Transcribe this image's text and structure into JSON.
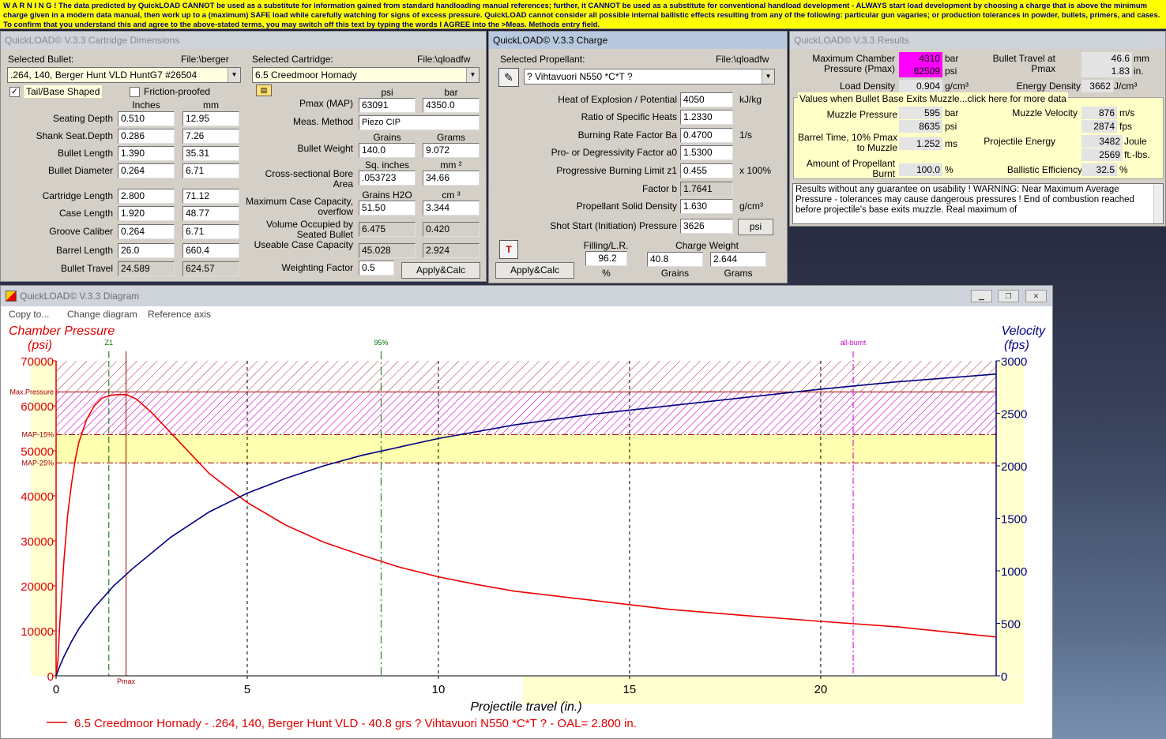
{
  "warning": "W A R N I N G ! The data predicted by QuickLOAD CANNOT be used as a substitute for information gained from standard handloading manual references; further, it CANNOT be used as a substitute for conventional handload development - ALWAYS start load development by choosing a charge that is above the minimum charge given in a modern data manual, then work up to a (maximum) SAFE load while carefully watching for signs of excess pressure. QuickLOAD cannot consider all possible internal ballistic effects resulting from any of the following: particular gun vagaries; or production tolerances in powder, bullets, primers, and cases. To confirm that you understand this and agree to the above-stated terms, you may switch off this text by typing the words I AGREE into the >Meas. Methods entry field.",
  "dims": {
    "title": "QuickLOAD© V.3.3 Cartridge Dimensions",
    "selected_bullet_label": "Selected Bullet:",
    "bullet_file": "File:\\berger",
    "bullet_value": ".264, 140, Berger Hunt VLD HuntG7 #26504",
    "tail_label": "Tail/Base Shaped",
    "friction_label": "Friction-proofed",
    "inches_hdr": "Inches",
    "mm_hdr": "mm",
    "rows": [
      {
        "label": "Seating Depth",
        "in": "0.510",
        "mm": "12.95"
      },
      {
        "label": "Shank Seat.Depth",
        "in": "0.286",
        "mm": "7.26"
      },
      {
        "label": "Bullet Length",
        "in": "1.390",
        "mm": "35.31"
      },
      {
        "label": "Bullet Diameter",
        "in": "0.264",
        "mm": "6.71"
      },
      {
        "label": "Cartridge Length",
        "in": "2.800",
        "mm": "71.12"
      },
      {
        "label": "Case Length",
        "in": "1.920",
        "mm": "48.77"
      },
      {
        "label": "Groove Caliber",
        "in": "0.264",
        "mm": "6.71"
      },
      {
        "label": "Barrel Length",
        "in": "26.0",
        "mm": "660.4"
      },
      {
        "label": "Bullet Travel",
        "in": "24.589",
        "mm": "624.57"
      }
    ],
    "selected_cartridge_label": "Selected Cartridge:",
    "cartridge_file": "File:\\qloadfw",
    "cartridge_value": "6.5 Creedmoor Hornady",
    "psi_hdr": "psi",
    "bar_hdr": "bar",
    "pmax_label": "Pmax (MAP)",
    "pmax_psi": "63091",
    "pmax_bar": "4350.0",
    "meas_label": "Meas. Method",
    "meas_value": "Piezo CIP",
    "grains_hdr": "Grains",
    "grams_hdr": "Grams",
    "bw_label": "Bullet Weight",
    "bw_gr": "140.0",
    "bw_g": "9.072",
    "sqin_hdr": "Sq. inches",
    "mm2_hdr": "mm ²",
    "csa_label1": "Cross-sectional Bore",
    "csa_label2": "Area",
    "csa_in": ".053723",
    "csa_mm": "34.66",
    "h2o_hdr": "Grains H2O",
    "cm3_hdr": "cm ³",
    "mcc_label1": "Maximum Case Capacity,",
    "mcc_label2": "overflow",
    "mcc_gr": "51.50",
    "mcc_cm": "3.344",
    "vol_label1": "Volume Occupied by",
    "vol_label2": "Seated Bullet",
    "vol_gr": "6.475",
    "vol_cm": "0.420",
    "ucc_label": "Useable Case Capacity",
    "ucc_gr": "45.028",
    "ucc_cm": "2.924",
    "wf_label": "Weighting Factor",
    "wf_value": "0.5",
    "apply": "Apply&Calc"
  },
  "charge": {
    "title": "QuickLOAD© V.3.3 Charge",
    "sel_label": "Selected Propellant:",
    "file": "File:\\qloadfw",
    "propellant": "? Vihtavuori N550 *C*T ?",
    "rows": [
      {
        "label": "Heat of Explosion / Potential",
        "value": "4050",
        "unit": "kJ/kg"
      },
      {
        "label": "Ratio of Specific Heats",
        "value": "1.2330",
        "unit": ""
      },
      {
        "label": "Burning Rate Factor  Ba",
        "value": "0.4700",
        "unit": "1/s"
      },
      {
        "label": "Pro- or Degressivity Factor  a0",
        "value": "1.5300",
        "unit": ""
      },
      {
        "label": "Progressive Burning Limit z1",
        "value": "0.455",
        "unit": "x 100%"
      },
      {
        "label": "Factor  b",
        "value": "1.7641",
        "unit": ""
      },
      {
        "label": "Propellant Solid Density",
        "value": "1.630",
        "unit": "g/cm³"
      },
      {
        "label": "Shot Start (Initiation) Pressure",
        "value": "3626",
        "unit": ""
      }
    ],
    "psi_btn": "psi",
    "filling_label": "Filling/L.R.",
    "filling_value": "96.2",
    "pct": "%",
    "cw_label": "Charge Weight",
    "cw_gr": "40.8",
    "cw_g": "2.644",
    "grains": "Grains",
    "grams": "Grams",
    "apply": "Apply&Calc"
  },
  "results": {
    "title": "QuickLOAD© V.3.3 Results",
    "mcp_label1": "Maximum Chamber",
    "mcp_label2": "Pressure (Pmax)",
    "mcp_bar": "4310",
    "mcp_psi": "62509",
    "bar": "bar",
    "psi": "psi",
    "btp_label1": "Bullet Travel at",
    "btp_label2": "Pmax",
    "btp_mm": "46.6",
    "btp_in": "1.83",
    "mm": "mm",
    "in": "in.",
    "ld_label": "Load Density",
    "ld_value": "0.904",
    "ld_unit": "g/cm³",
    "ed_label": "Energy Density",
    "ed_value": "3662",
    "ed_unit": "J/cm³",
    "group_title": "Values when Bullet Base Exits Muzzle...click here for more data",
    "mp_label": "Muzzle Pressure",
    "mp_bar": "595",
    "mp_psi": "8635",
    "mv_label": "Muzzle Velocity",
    "mv_ms": "876",
    "mv_fps": "2874",
    "ms": "m/s",
    "fps": "fps",
    "bt_label1": "Barrel Time, 10% Pmax",
    "bt_label2": "to Muzzle",
    "bt_value": "1.252",
    "ms_unit": "ms",
    "pe_label": "Projectile Energy",
    "pe_j": "3482",
    "pe_ft": "2569",
    "joule": "Joule",
    "ftlbs": "ft.-lbs.",
    "ap_label1": "Amount of Propellant",
    "ap_label2": "Burnt",
    "ap_value": "100.0",
    "pct": "%",
    "be_label": "Ballistic Efficiency",
    "be_value": "32.5",
    "note": "Results without any guarantee on usability !  WARNING: Near Maximum Average Pressure - tolerances may cause dangerous pressures !  End of combustion reached before projectile's base exits muzzle.  Real maximum of"
  },
  "diagram": {
    "title": "QuickLOAD© V.3.3 Diagram",
    "menu": [
      "Copy to...",
      "Change diagram",
      "Reference axis"
    ],
    "icons": {
      "minimize": "minimize-icon",
      "restore": "restore-icon",
      "close": "close-icon"
    }
  },
  "chart_data": {
    "type": "line",
    "title": "",
    "xlabel": "Projectile travel (in.)",
    "ylabel_left": "Chamber Pressure (psi)",
    "ylabel_right": "Velocity (fps)",
    "xlim": [
      0,
      24.589
    ],
    "ylim_left": [
      0,
      70000
    ],
    "ylim_right": [
      0,
      3000
    ],
    "xticks": [
      0,
      5,
      10,
      15,
      20
    ],
    "yticks_left": [
      0,
      10000,
      20000,
      30000,
      40000,
      50000,
      60000,
      70000
    ],
    "yticks_right": [
      0,
      500,
      1000,
      1500,
      2000,
      2500,
      3000
    ],
    "reference_lines": [
      {
        "label": "Max.Pressure",
        "value": 63091
      },
      {
        "label": "MAP-15%",
        "value": 53627
      },
      {
        "label": "MAP-25%",
        "value": 47318
      }
    ],
    "markers": [
      {
        "label": "Z1",
        "x": 1.38
      },
      {
        "label": "Pmax",
        "x": 1.83
      },
      {
        "label": "95%",
        "x": 8.5
      },
      {
        "label": "all-burnt",
        "x": 20.85
      }
    ],
    "legend": "6.5 Creedmoor Hornady - .264, 140, Berger Hunt VLD - 40.8 grs ? Vihtavuori N550 *C*T ? - OAL= 2.800 in.",
    "colors": {
      "pressure": "#ee0000",
      "velocity": "#000080"
    },
    "series": [
      {
        "name": "Chamber Pressure",
        "axis": "left",
        "x": [
          0,
          0.05,
          0.1,
          0.2,
          0.3,
          0.4,
          0.5,
          0.6,
          0.8,
          1.0,
          1.2,
          1.4,
          1.6,
          1.83,
          2.1,
          2.5,
          3.0,
          3.5,
          4.0,
          5.0,
          6.0,
          7.0,
          8.0,
          9.0,
          10.0,
          11.0,
          12.0,
          14.0,
          16.0,
          18.0,
          20.0,
          22.0,
          24.589
        ],
        "y": [
          0,
          3600,
          12000,
          25000,
          35500,
          42500,
          48000,
          52000,
          57000,
          60000,
          61700,
          62300,
          62500,
          62509,
          61500,
          58500,
          54000,
          49500,
          45000,
          38500,
          33500,
          29700,
          26800,
          24100,
          22000,
          20300,
          18800,
          16800,
          14800,
          13400,
          12100,
          10900,
          8635
        ]
      },
      {
        "name": "Velocity",
        "axis": "right",
        "x": [
          0,
          0.1,
          0.2,
          0.4,
          0.6,
          1.0,
          1.5,
          2.0,
          3.0,
          4.0,
          5.0,
          6.0,
          7.0,
          8.0,
          10.0,
          12.0,
          14.0,
          16.0,
          18.0,
          20.0,
          22.0,
          24.589
        ],
        "y": [
          0,
          95,
          180,
          325,
          450,
          650,
          855,
          1020,
          1320,
          1560,
          1740,
          1880,
          2000,
          2100,
          2260,
          2390,
          2490,
          2570,
          2650,
          2730,
          2800,
          2874
        ]
      }
    ]
  }
}
